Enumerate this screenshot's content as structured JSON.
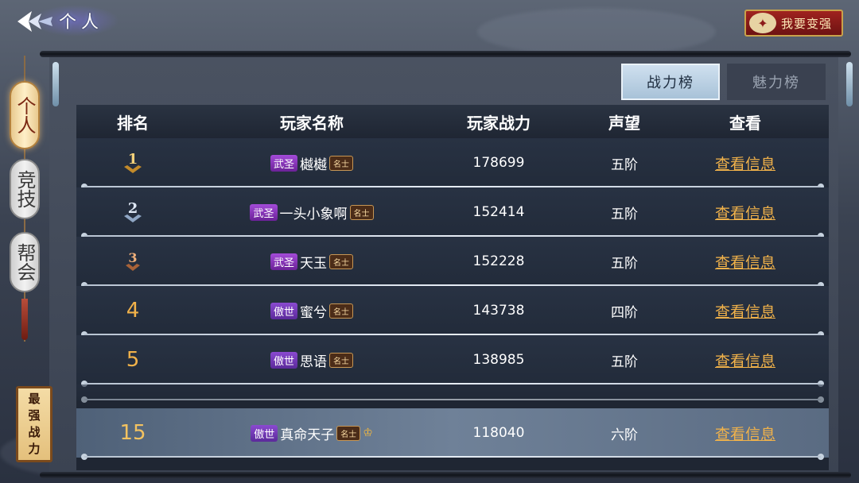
{
  "header": {
    "title": "个人",
    "stronger_label": "我要变强"
  },
  "side_tabs": [
    {
      "label": "个人",
      "active": true
    },
    {
      "label": "竞技",
      "active": false
    },
    {
      "label": "帮会",
      "active": false
    }
  ],
  "strongest_label": [
    "最",
    "强",
    "战",
    "力"
  ],
  "rank_tabs": [
    {
      "label": "战力榜",
      "active": true
    },
    {
      "label": "魅力榜",
      "active": false
    }
  ],
  "table": {
    "headers": [
      "排名",
      "玩家名称",
      "玩家战力",
      "声望",
      "查看"
    ],
    "rows": [
      {
        "rank": "1",
        "medal": "gold",
        "title": "武圣",
        "name": "樾樾",
        "badge": "名士",
        "power": "178699",
        "fame": "五阶",
        "view": "查看信息"
      },
      {
        "rank": "2",
        "medal": "silver",
        "title": "武圣",
        "name": "一头小象啊",
        "badge": "名士",
        "power": "152414",
        "fame": "五阶",
        "view": "查看信息"
      },
      {
        "rank": "3",
        "medal": "bronze",
        "title": "武圣",
        "name": "天玉",
        "badge": "名士",
        "power": "152228",
        "fame": "五阶",
        "view": "查看信息"
      },
      {
        "rank": "4",
        "medal": "",
        "title": "傲世",
        "name": "蜜兮",
        "badge": "名士",
        "power": "143738",
        "fame": "四阶",
        "view": "查看信息"
      },
      {
        "rank": "5",
        "medal": "",
        "title": "傲世",
        "name": "思语",
        "badge": "名士",
        "power": "138985",
        "fame": "五阶",
        "view": "查看信息"
      }
    ],
    "self_row": {
      "rank": "15",
      "title": "傲世",
      "name": "真命天子",
      "badge": "名士",
      "power": "118040",
      "fame": "六阶",
      "view": "查看信息"
    }
  },
  "colors": {
    "accent_gold": "#f1b24a",
    "title_purple": "#a34bd8"
  }
}
